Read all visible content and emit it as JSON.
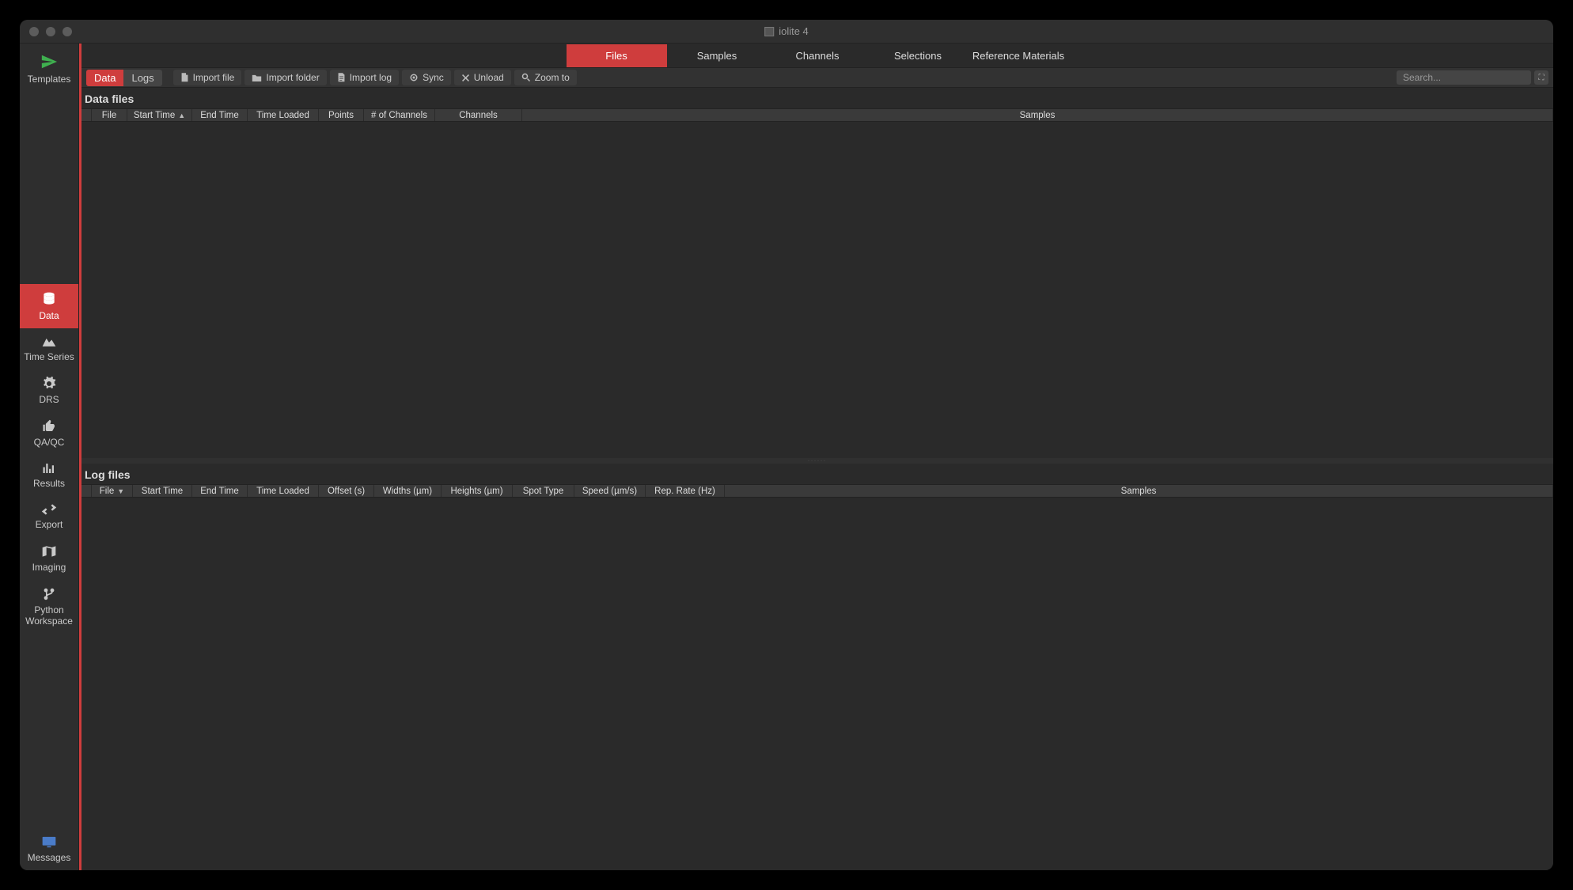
{
  "window": {
    "title": "iolite 4"
  },
  "sidebar": {
    "templates": "Templates",
    "data": "Data",
    "timeseries": "Time Series",
    "drs": "DRS",
    "qaqc": "QA/QC",
    "results": "Results",
    "export": "Export",
    "imaging": "Imaging",
    "python1": "Python",
    "python2": "Workspace",
    "messages": "Messages"
  },
  "top_tabs": {
    "files": "Files",
    "samples": "Samples",
    "channels": "Channels",
    "selections": "Selections",
    "refmat": "Reference Materials"
  },
  "toolbar": {
    "mode_data": "Data",
    "mode_logs": "Logs",
    "import_file": "Import file",
    "import_folder": "Import folder",
    "import_log": "Import log",
    "sync": "Sync",
    "unload": "Unload",
    "zoom_to": "Zoom to",
    "search_placeholder": "Search..."
  },
  "sections": {
    "data_files": "Data files",
    "log_files": "Log files"
  },
  "data_table_headers": {
    "file": "File",
    "start_time": "Start Time",
    "end_time": "End Time",
    "time_loaded": "Time Loaded",
    "points": "Points",
    "num_channels": "# of Channels",
    "channels": "Channels",
    "samples": "Samples"
  },
  "log_table_headers": {
    "file": "File",
    "start_time": "Start Time",
    "end_time": "End Time",
    "time_loaded": "Time Loaded",
    "offset": "Offset (s)",
    "widths": "Widths (µm)",
    "heights": "Heights (µm)",
    "spot_type": "Spot Type",
    "speed": "Speed (µm/s)",
    "rep_rate": "Rep. Rate (Hz)",
    "samples": "Samples"
  }
}
